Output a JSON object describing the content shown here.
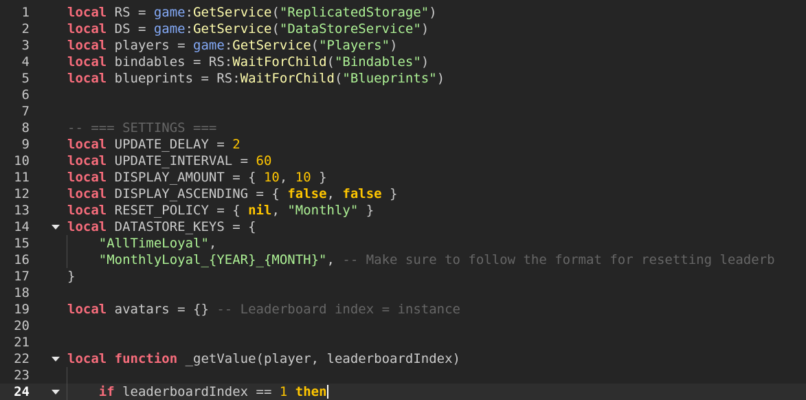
{
  "editor": {
    "current_line": 24,
    "folded_lines": [
      14,
      22,
      24
    ],
    "colors": {
      "background": "#252525",
      "current_line": "#2e2e2e",
      "keyword": "#f86d7c",
      "builtin": "#84aaf8",
      "method": "#fdfbac",
      "string": "#adf195",
      "number": "#ffc600",
      "comment": "#666666",
      "text": "#cccccc"
    },
    "lines": [
      {
        "n": "1",
        "tokens": [
          [
            "kw",
            "local"
          ],
          [
            "id",
            " RS = "
          ],
          [
            "gl",
            "game"
          ],
          [
            "id",
            ":"
          ],
          [
            "fn",
            "GetService"
          ],
          [
            "id",
            "("
          ],
          [
            "str",
            "\"ReplicatedStorage\""
          ],
          [
            "id",
            ")"
          ]
        ]
      },
      {
        "n": "2",
        "tokens": [
          [
            "kw",
            "local"
          ],
          [
            "id",
            " DS = "
          ],
          [
            "gl",
            "game"
          ],
          [
            "id",
            ":"
          ],
          [
            "fn",
            "GetService"
          ],
          [
            "id",
            "("
          ],
          [
            "str",
            "\"DataStoreService\""
          ],
          [
            "id",
            ")"
          ]
        ]
      },
      {
        "n": "3",
        "tokens": [
          [
            "kw",
            "local"
          ],
          [
            "id",
            " players = "
          ],
          [
            "gl",
            "game"
          ],
          [
            "id",
            ":"
          ],
          [
            "fn",
            "GetService"
          ],
          [
            "id",
            "("
          ],
          [
            "str",
            "\"Players\""
          ],
          [
            "id",
            ")"
          ]
        ]
      },
      {
        "n": "4",
        "tokens": [
          [
            "kw",
            "local"
          ],
          [
            "id",
            " bindables = RS:"
          ],
          [
            "fn",
            "WaitForChild"
          ],
          [
            "id",
            "("
          ],
          [
            "str",
            "\"Bindables\""
          ],
          [
            "id",
            ")"
          ]
        ]
      },
      {
        "n": "5",
        "tokens": [
          [
            "kw",
            "local"
          ],
          [
            "id",
            " blueprints = RS:"
          ],
          [
            "fn",
            "WaitForChild"
          ],
          [
            "id",
            "("
          ],
          [
            "str",
            "\"Blueprints\""
          ],
          [
            "id",
            ")"
          ]
        ]
      },
      {
        "n": "6",
        "tokens": []
      },
      {
        "n": "7",
        "tokens": []
      },
      {
        "n": "8",
        "tokens": [
          [
            "cm",
            "-- === SETTINGS ==="
          ]
        ]
      },
      {
        "n": "9",
        "tokens": [
          [
            "kw",
            "local"
          ],
          [
            "id",
            " UPDATE_DELAY = "
          ],
          [
            "num",
            "2"
          ]
        ]
      },
      {
        "n": "10",
        "tokens": [
          [
            "kw",
            "local"
          ],
          [
            "id",
            " UPDATE_INTERVAL = "
          ],
          [
            "num",
            "60"
          ]
        ]
      },
      {
        "n": "11",
        "tokens": [
          [
            "kw",
            "local"
          ],
          [
            "id",
            " DISPLAY_AMOUNT = { "
          ],
          [
            "num",
            "10"
          ],
          [
            "id",
            ", "
          ],
          [
            "num",
            "10"
          ],
          [
            "id",
            " }"
          ]
        ]
      },
      {
        "n": "12",
        "tokens": [
          [
            "kw",
            "local"
          ],
          [
            "id",
            " DISPLAY_ASCENDING = { "
          ],
          [
            "kw2",
            "false"
          ],
          [
            "id",
            ", "
          ],
          [
            "kw2",
            "false"
          ],
          [
            "id",
            " }"
          ]
        ]
      },
      {
        "n": "13",
        "tokens": [
          [
            "kw",
            "local"
          ],
          [
            "id",
            " RESET_POLICY = { "
          ],
          [
            "kw2",
            "nil"
          ],
          [
            "id",
            ", "
          ],
          [
            "str",
            "\"Monthly\""
          ],
          [
            "id",
            " }"
          ]
        ]
      },
      {
        "n": "14",
        "tokens": [
          [
            "kw",
            "local"
          ],
          [
            "id",
            " DATASTORE_KEYS = {"
          ]
        ]
      },
      {
        "n": "15",
        "tokens": [
          [
            "id",
            "    "
          ],
          [
            "str",
            "\"AllTimeLoyal\""
          ],
          [
            "id",
            ","
          ]
        ]
      },
      {
        "n": "16",
        "tokens": [
          [
            "id",
            "    "
          ],
          [
            "str",
            "\"MonthlyLoyal_{YEAR}_{MONTH}\""
          ],
          [
            "id",
            ", "
          ],
          [
            "cm",
            "-- Make sure to follow the format for resetting leaderb"
          ]
        ]
      },
      {
        "n": "17",
        "tokens": [
          [
            "id",
            "}"
          ]
        ]
      },
      {
        "n": "18",
        "tokens": []
      },
      {
        "n": "19",
        "tokens": [
          [
            "kw",
            "local"
          ],
          [
            "id",
            " avatars = {} "
          ],
          [
            "cm",
            "-- Leaderboard index = instance"
          ]
        ]
      },
      {
        "n": "20",
        "tokens": []
      },
      {
        "n": "21",
        "tokens": []
      },
      {
        "n": "22",
        "tokens": [
          [
            "kw",
            "local"
          ],
          [
            "id",
            " "
          ],
          [
            "kw",
            "function"
          ],
          [
            "id",
            " _getValue(player, leaderboardIndex)"
          ]
        ]
      },
      {
        "n": "23",
        "tokens": []
      },
      {
        "n": "24",
        "tokens": [
          [
            "id",
            "    "
          ],
          [
            "kw",
            "if"
          ],
          [
            "id",
            " leaderboardIndex == "
          ],
          [
            "num",
            "1"
          ],
          [
            "id",
            " "
          ],
          [
            "kw2",
            "then"
          ]
        ]
      }
    ]
  }
}
